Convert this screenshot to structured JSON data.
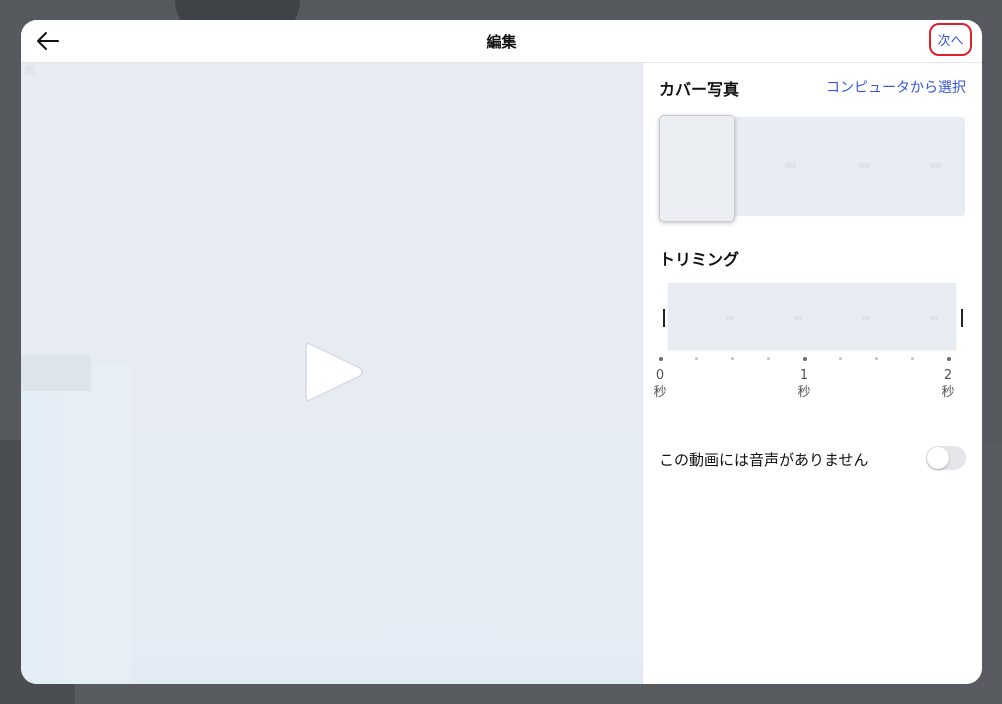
{
  "header": {
    "back_icon": "arrow-left-icon",
    "title": "編集",
    "next_label": "次へ",
    "next_highlight_color": "#e0202a"
  },
  "preview": {
    "play_icon": "play-icon"
  },
  "cover": {
    "title": "カバー写真",
    "pick_label": "コンピュータから選択"
  },
  "trim": {
    "title": "トリミング",
    "labels": [
      {
        "value": "0",
        "unit": "秒"
      },
      {
        "value": "1",
        "unit": "秒"
      },
      {
        "value": "2",
        "unit": "秒"
      }
    ]
  },
  "audio": {
    "label": "この動画には音声がありません",
    "toggle_on": false
  },
  "colors": {
    "accent": "#3a57d6",
    "backdrop": "#56595e"
  }
}
